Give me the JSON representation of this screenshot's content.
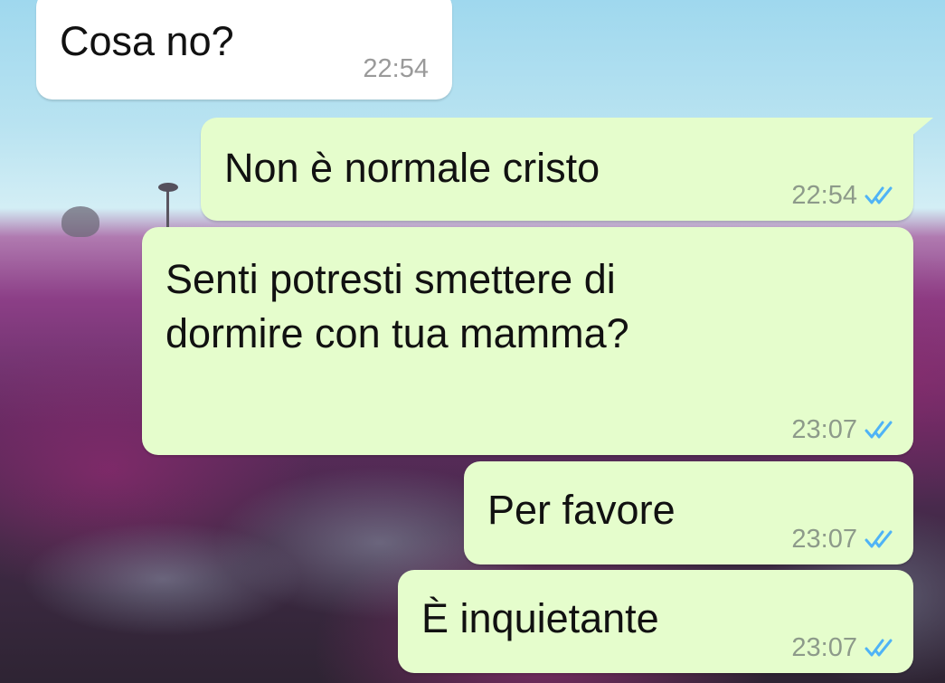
{
  "accent": {
    "incoming_bubble": "#ffffff",
    "outgoing_bubble": "#e5fdcc",
    "read_check": "#4fb3f6",
    "timestamp_gray": "#9a9a9a"
  },
  "messages": [
    {
      "direction": "incoming",
      "text": "Cosa no?",
      "time": "22:54",
      "status": ""
    },
    {
      "direction": "outgoing",
      "text": "Non è normale cristo",
      "time": "22:54",
      "status": "read",
      "status_icon": "double-check-icon"
    },
    {
      "direction": "outgoing",
      "text": "Senti potresti smettere di\ndormire con tua mamma?",
      "time": "23:07",
      "status": "read",
      "status_icon": "double-check-icon"
    },
    {
      "direction": "outgoing",
      "text": "Per favore",
      "time": "23:07",
      "status": "read",
      "status_icon": "double-check-icon"
    },
    {
      "direction": "outgoing",
      "text": "È inquietante",
      "time": "23:07",
      "status": "read",
      "status_icon": "double-check-icon"
    }
  ]
}
